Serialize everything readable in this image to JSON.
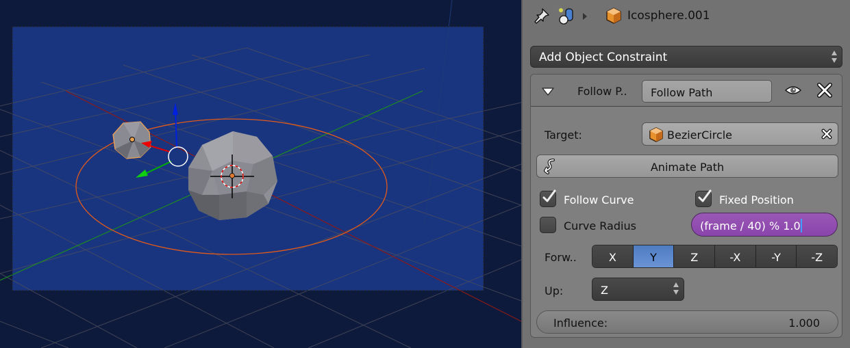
{
  "viewport": {
    "background_color": "#0d1a3c",
    "camera_frame_color": "#193580",
    "grid_color": "#4a4a5a",
    "x_axis_color": "#8b1a1a",
    "y_axis_color": "#1e8c1e",
    "path_color": "#e05a1a",
    "objects": [
      "Icosphere.001",
      "Icosphere",
      "BezierCircle"
    ]
  },
  "header": {
    "pin_icon": "pin-icon",
    "context_icon": "object-data-icon",
    "object_name": "Icosphere.001"
  },
  "add_constraint": {
    "label": "Add Object Constraint"
  },
  "constraint": {
    "short_name": "Follow P..",
    "name_value": "Follow Path",
    "target_label": "Target:",
    "target_value": "BezierCircle",
    "animate_path_label": "Animate Path",
    "follow_curve_label": "Follow Curve",
    "follow_curve_checked": true,
    "fixed_position_label": "Fixed Position",
    "fixed_position_checked": true,
    "curve_radius_label": "Curve Radius",
    "curve_radius_checked": false,
    "offset_expression": "(frame / 40) % 1.0",
    "forward_label": "Forw..",
    "forward_options": [
      "X",
      "Y",
      "Z",
      "-X",
      "-Y",
      "-Z"
    ],
    "forward_selected": "Y",
    "up_label": "Up:",
    "up_value": "Z",
    "influence_label": "Influence:",
    "influence_value": "1.000"
  },
  "colors": {
    "panel_bg": "#727272",
    "accent_blue": "#5a86cc",
    "driver_purple": "#9450b0",
    "object_orange": "#e8922e"
  }
}
